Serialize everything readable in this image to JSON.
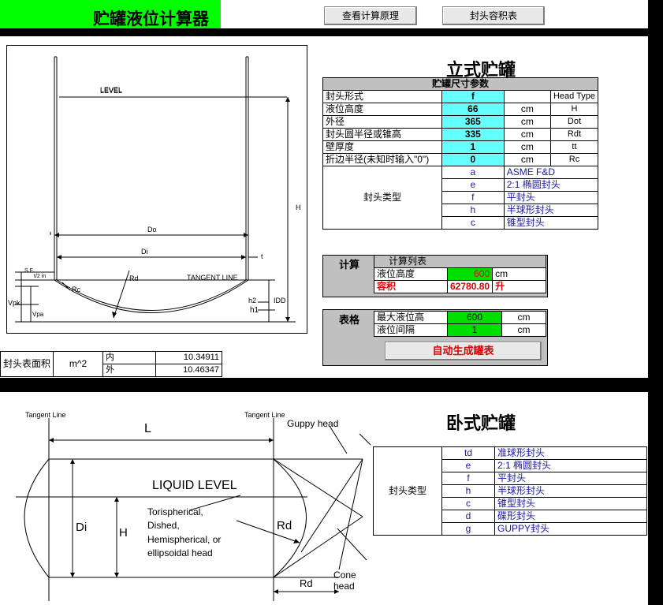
{
  "app_title": "贮罐液位计算器",
  "buttons": {
    "principle": "查看计算原理",
    "volume_table": "封头容积表",
    "generate": "自动生成罐表"
  },
  "vertical": {
    "heading": "立式贮罐",
    "params_title": "贮罐尺寸参数",
    "params": [
      {
        "label": "封头形式",
        "value": "f",
        "unit": "",
        "code": "Head Type"
      },
      {
        "label": "液位高度",
        "value": "66",
        "unit": "cm",
        "code": "H"
      },
      {
        "label": "外径",
        "value": "365",
        "unit": "cm",
        "code": "Dot"
      },
      {
        "label": "封头圆半径或锥高",
        "value": "335",
        "unit": "cm",
        "code": "Rdt"
      },
      {
        "label": "壁厚度",
        "value": "1",
        "unit": "cm",
        "code": "tt"
      },
      {
        "label": "折边半径(未知时输入\"0\")",
        "value": "0",
        "unit": "cm",
        "code": "Rc"
      }
    ],
    "head_types_label": "封头类型",
    "head_types": [
      {
        "code": "a",
        "name": "ASME F&D"
      },
      {
        "code": "e",
        "name": "2:1 椭圆封头"
      },
      {
        "code": "f",
        "name": "平封头"
      },
      {
        "code": "h",
        "name": "半球形封头"
      },
      {
        "code": "c",
        "name": "锥型封头"
      }
    ],
    "calc": {
      "label": "计算",
      "list_title": "计算列表",
      "level_label": "液位高度",
      "level_value": "600",
      "level_unit": "cm",
      "volume_label": "容积",
      "volume_value": "62780.80",
      "volume_unit": "升"
    },
    "table": {
      "label": "表格",
      "max_label": "最大液位高",
      "max_value": "600",
      "max_unit": "cm",
      "interval_label": "液位间隔",
      "interval_value": "1",
      "interval_unit": "cm"
    },
    "surface": {
      "label": "封头表面积",
      "unit": "m^2",
      "inner_label": "内",
      "inner_value": "10.34911",
      "outer_label": "外",
      "outer_value": "10.46347"
    },
    "diagram": {
      "level": "LEVEL",
      "H": "H",
      "Do": "Do",
      "Di": "Di",
      "t": "t",
      "Rd": "Rd",
      "tangent": "TANGENT LINE",
      "Rc": "Rc",
      "IDD": "IDD",
      "h1": "h1",
      "h2": "h2",
      "Vpk": "Vpk",
      "Vpa": "Vpa",
      "sf": "S.F.",
      "t2": "t/2 in"
    }
  },
  "horizontal": {
    "heading": "卧式贮罐",
    "head_types_label": "封头类型",
    "head_types": [
      {
        "code": "td",
        "name": "准球形封头"
      },
      {
        "code": "e",
        "name": "2:1 椭圆封头"
      },
      {
        "code": "f",
        "name": "平封头"
      },
      {
        "code": "h",
        "name": "半球形封头"
      },
      {
        "code": "c",
        "name": "锥型封头"
      },
      {
        "code": "d",
        "name": "碟形封头"
      },
      {
        "code": "g",
        "name": "GUPPY封头"
      }
    ],
    "diagram": {
      "tangent_left": "Tangent Line",
      "tangent_right": "Tangent Line",
      "L": "L",
      "liquid": "LIQUID LEVEL",
      "Di": "Di",
      "H": "H",
      "Rd": "Rd",
      "Rd2": "Rd",
      "note_lines": [
        "Torispherical,",
        "Dished,",
        "Hemispherical, or",
        "ellipsoidal head"
      ],
      "guppy": "Guppy head",
      "cone": "Cone head"
    }
  }
}
